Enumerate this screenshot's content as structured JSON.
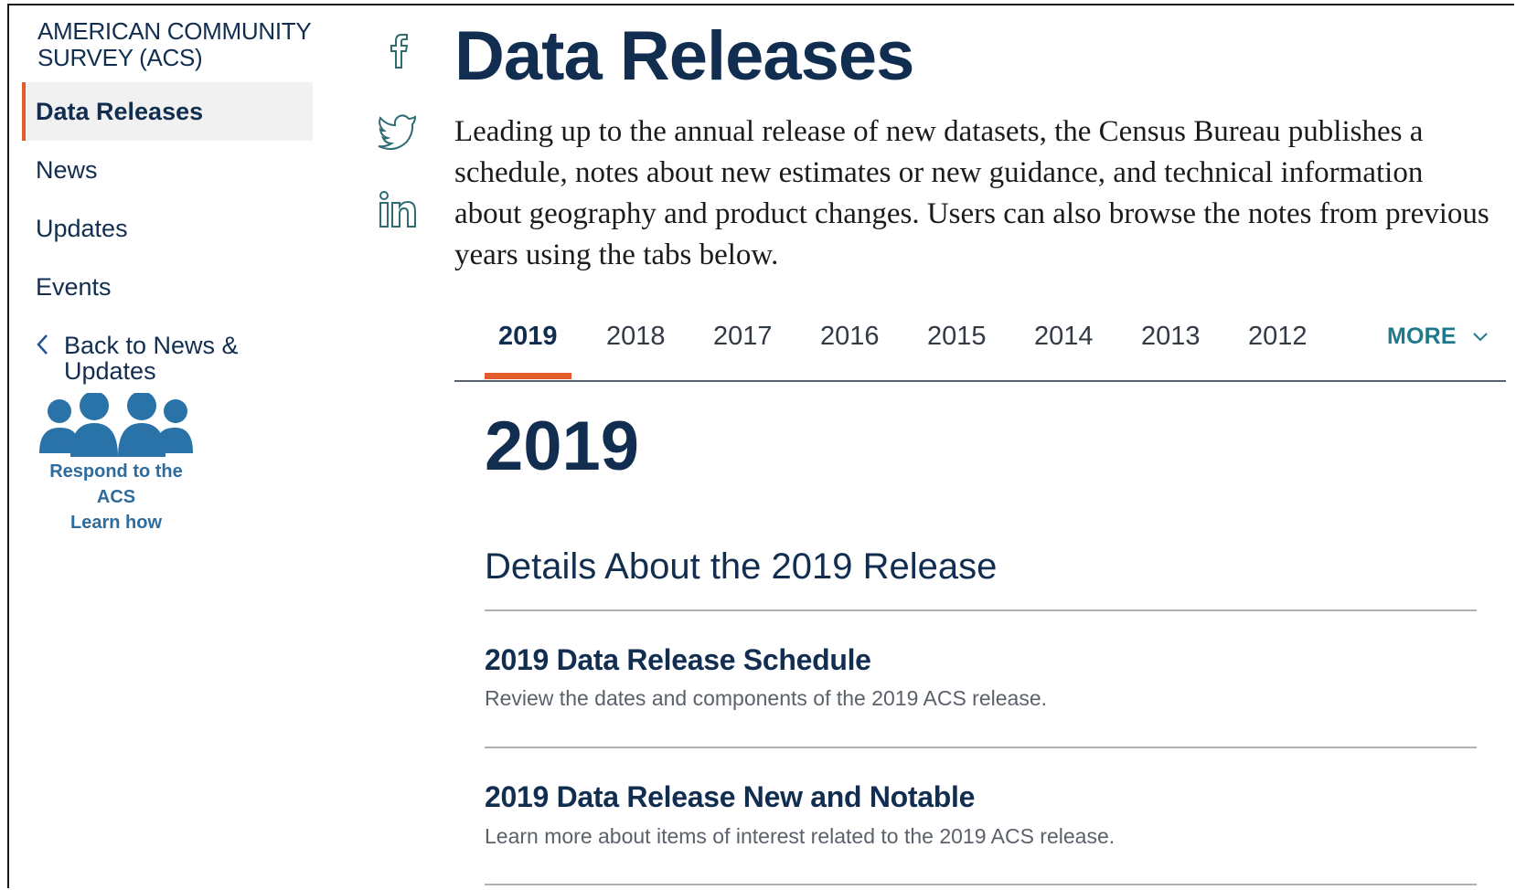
{
  "sidebar": {
    "title": "AMERICAN COMMUNITY SURVEY (ACS)",
    "items": [
      {
        "label": "Data Releases",
        "active": true
      },
      {
        "label": "News"
      },
      {
        "label": "Updates"
      },
      {
        "label": "Events"
      }
    ],
    "back_link": "Back to News & Updates",
    "respond": {
      "line1": "Respond to the ACS",
      "line2": "Learn how",
      "icon": "people-group-icon"
    }
  },
  "social": [
    "facebook-icon",
    "twitter-icon",
    "linkedin-icon"
  ],
  "main": {
    "title": "Data Releases",
    "intro": "Leading up to the annual release of new datasets, the Census Bureau publishes a schedule, notes about new estimates or new guidance, and technical information about geography and product changes. Users can also browse the notes from previous years using the tabs below.",
    "tabs": [
      "2019",
      "2018",
      "2017",
      "2016",
      "2015",
      "2014",
      "2013",
      "2012"
    ],
    "active_tab": "2019",
    "more_label": "MORE",
    "year_heading": "2019",
    "section_heading": "Details About the 2019 Release",
    "items": [
      {
        "title": "2019 Data Release Schedule",
        "desc": "Review the dates and components of the 2019 ACS release."
      },
      {
        "title": "2019 Data Release New and Notable",
        "desc": "Learn more about items of interest related to the 2019 ACS release."
      }
    ]
  },
  "colors": {
    "navy": "#112e51",
    "accent": "#e25d2c",
    "teal": "#1e7a8a",
    "link_blue": "#2e6c9e"
  }
}
